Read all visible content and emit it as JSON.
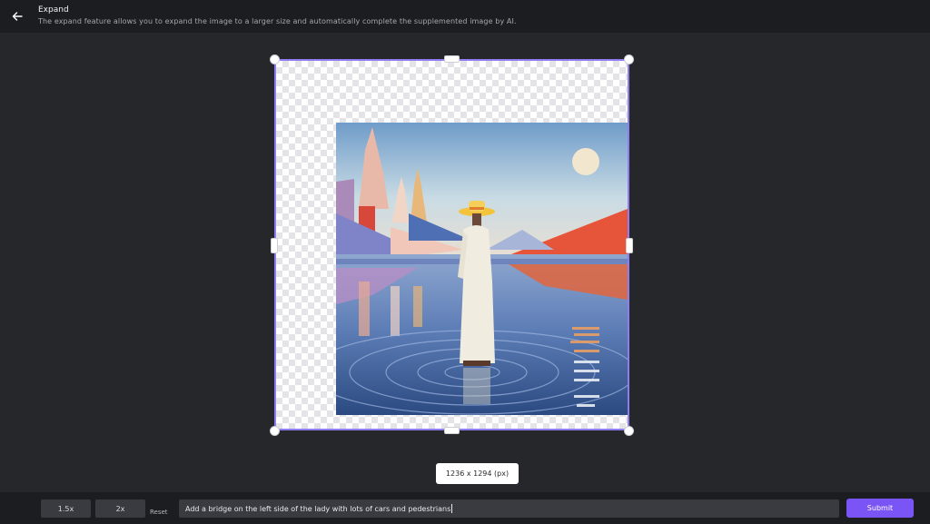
{
  "header": {
    "title": "Expand",
    "description": "The expand feature allows you to expand the image to a larger size and automatically complete the supplemented image by AI."
  },
  "canvas": {
    "size_label": "1236 x 1294 (px)",
    "frame_color": "#8f7cf0"
  },
  "toolbar": {
    "scale_options": [
      "1.5x",
      "2x"
    ],
    "reset_label": "Reset",
    "prompt_value": "Add a bridge on the left side of the lady with lots of cars and pedestrians",
    "submit_label": "Submit",
    "submit_color": "#7b54f5"
  },
  "icons": {
    "back": "arrow-left-icon"
  }
}
